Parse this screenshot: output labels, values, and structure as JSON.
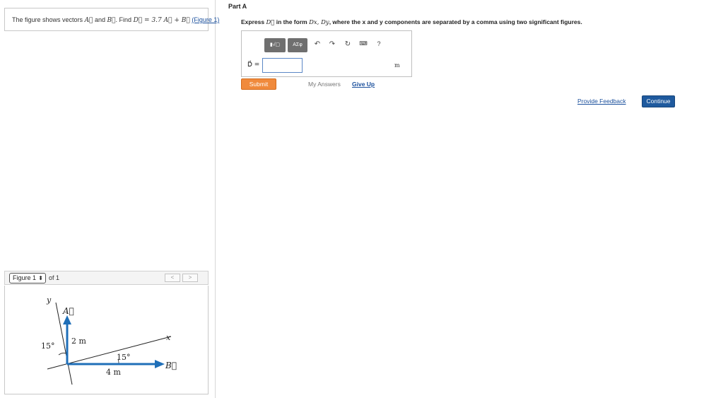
{
  "problem": {
    "text_prefix": "The figure shows vectors",
    "vec_a": "A⃗",
    "and": "and",
    "vec_b": "B⃗",
    "find": ". Find",
    "expression": "D⃗ = 3.7 A⃗ + B⃗",
    "figure_link": "(Figure 1)"
  },
  "figure_nav": {
    "select_value": "Figure 1",
    "of_text": "of 1",
    "prev": "<",
    "next": ">"
  },
  "figure": {
    "label_y": "y",
    "label_x": "x",
    "label_a": "A⃗",
    "label_b": "B⃗",
    "angle_left": "15°",
    "angle_bottom": "15°",
    "mag_a": "2 m",
    "mag_b": "4 m",
    "vector_color": "#1f6fb8"
  },
  "part": {
    "title": "Part A",
    "instruction_prefix": "Express",
    "instruction_var": "D⃗",
    "instruction_mid": "in the form",
    "instruction_form": "Dx, Dy",
    "instruction_suffix": ", where the x and y components are separated by a comma using two significant figures."
  },
  "toolbar": {
    "template_btn": "▮√▢",
    "greek_btn": "ΑΣφ",
    "undo_icon": "undo-icon",
    "redo_icon": "redo-icon",
    "reset_icon": "reset-icon",
    "keyboard_icon": "keyboard-icon",
    "help_label": "?"
  },
  "answer": {
    "label": "D⃗ =",
    "value": "",
    "unit": "m"
  },
  "actions": {
    "submit": "Submit",
    "my_answers": "My Answers",
    "give_up": "Give Up",
    "feedback": "Provide Feedback",
    "continue": "Continue"
  }
}
